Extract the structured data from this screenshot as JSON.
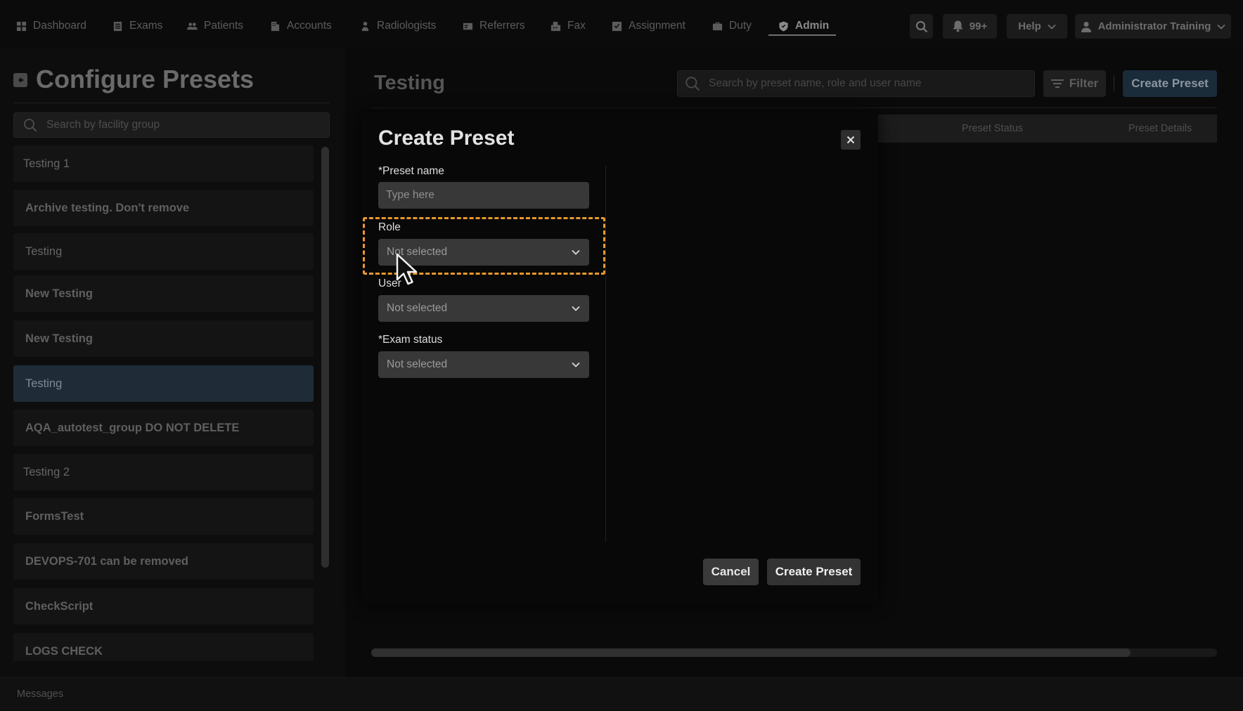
{
  "nav": {
    "items": [
      {
        "label": "Dashboard",
        "icon": "grid-icon"
      },
      {
        "label": "Exams",
        "icon": "list-icon"
      },
      {
        "label": "Patients",
        "icon": "users-icon"
      },
      {
        "label": "Accounts",
        "icon": "building-icon"
      },
      {
        "label": "Radiologists",
        "icon": "person-icon"
      },
      {
        "label": "Referrers",
        "icon": "card-icon"
      },
      {
        "label": "Fax",
        "icon": "fax-icon"
      },
      {
        "label": "Assignment",
        "icon": "check-square-icon"
      },
      {
        "label": "Duty",
        "icon": "briefcase-icon"
      },
      {
        "label": "Admin",
        "icon": "shield-icon",
        "active": true
      }
    ],
    "notification_count": "99+",
    "help_label": "Help",
    "user_name": "Administrator Training"
  },
  "left_panel": {
    "title": "Configure Presets",
    "search_placeholder": "Search by facility group",
    "groups": [
      "Testing 1",
      "Archive testing. Don't remove",
      "Testing",
      "New Testing",
      "New Testing",
      "Testing",
      "AQA_autotest_group DO NOT DELETE",
      "Testing 2",
      "FormsTest",
      "DEVOPS-701 can be removed",
      "CheckScript",
      "LOGS CHECK"
    ],
    "selected_index": 5
  },
  "main": {
    "title": "Testing",
    "search_placeholder": "Search by preset name, role and user name",
    "filter_label": "Filter",
    "create_label": "Create Preset",
    "columns": [
      "Preset Status",
      "Preset Details"
    ]
  },
  "modal": {
    "title": "Create Preset",
    "preset_name_label": "*Preset name",
    "preset_name_placeholder": "Type here",
    "role_label": "Role",
    "role_value": "Not selected",
    "user_label": "User",
    "user_value": "Not selected",
    "exam_status_label": "*Exam status",
    "exam_status_value": "Not selected",
    "cancel_label": "Cancel",
    "submit_label": "Create Preset"
  },
  "footer": {
    "messages_label": "Messages"
  },
  "colors": {
    "highlight": "#e8992c",
    "selected_item": "#1f2c38"
  }
}
